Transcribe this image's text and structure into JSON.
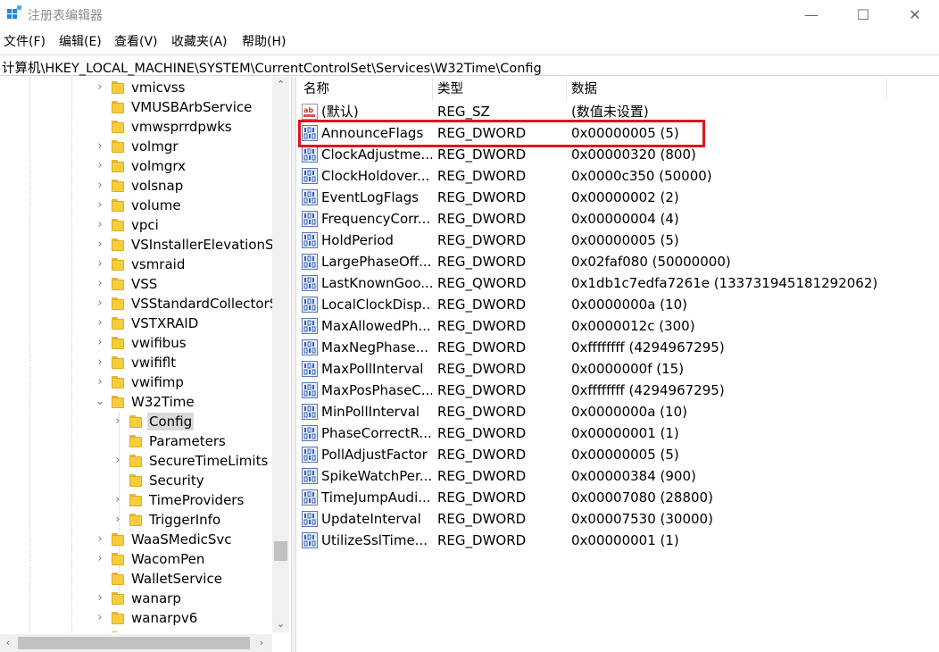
{
  "window": {
    "title": "注册表编辑器",
    "min_glyph": "—",
    "max_glyph": "☐",
    "close_glyph": "✕"
  },
  "menu": [
    "文件(F)",
    "编辑(E)",
    "查看(V)",
    "收藏夹(A)",
    "帮助(H)"
  ],
  "address": "计算机\\HKEY_LOCAL_MACHINE\\SYSTEM\\CurrentControlSet\\Services\\W32Time\\Config",
  "tree": {
    "nodes": [
      {
        "label": "vmicvss",
        "expander": "›",
        "depth": 0
      },
      {
        "label": "VMUSBArbService",
        "expander": "",
        "depth": 0
      },
      {
        "label": "vmwsprrdpwks",
        "expander": "",
        "depth": 0
      },
      {
        "label": "volmgr",
        "expander": "›",
        "depth": 0
      },
      {
        "label": "volmgrx",
        "expander": "›",
        "depth": 0
      },
      {
        "label": "volsnap",
        "expander": "›",
        "depth": 0
      },
      {
        "label": "volume",
        "expander": "›",
        "depth": 0
      },
      {
        "label": "vpci",
        "expander": "›",
        "depth": 0
      },
      {
        "label": "VSInstallerElevationService",
        "expander": "›",
        "depth": 0
      },
      {
        "label": "vsmraid",
        "expander": "›",
        "depth": 0
      },
      {
        "label": "VSS",
        "expander": "›",
        "depth": 0
      },
      {
        "label": "VSStandardCollectorService150",
        "expander": "›",
        "depth": 0
      },
      {
        "label": "VSTXRAID",
        "expander": "›",
        "depth": 0
      },
      {
        "label": "vwifibus",
        "expander": "›",
        "depth": 0
      },
      {
        "label": "vwififlt",
        "expander": "›",
        "depth": 0
      },
      {
        "label": "vwifimp",
        "expander": "›",
        "depth": 0
      },
      {
        "label": "W32Time",
        "expander": "⌄",
        "depth": 0
      },
      {
        "label": "Config",
        "expander": "›",
        "depth": 1,
        "selected": true
      },
      {
        "label": "Parameters",
        "expander": "",
        "depth": 1
      },
      {
        "label": "SecureTimeLimits",
        "expander": "›",
        "depth": 1
      },
      {
        "label": "Security",
        "expander": "",
        "depth": 1
      },
      {
        "label": "TimeProviders",
        "expander": "›",
        "depth": 1
      },
      {
        "label": "TriggerInfo",
        "expander": "›",
        "depth": 1
      },
      {
        "label": "WaaSMedicSvc",
        "expander": "›",
        "depth": 0
      },
      {
        "label": "WacomPen",
        "expander": "›",
        "depth": 0
      },
      {
        "label": "WalletService",
        "expander": "",
        "depth": 0
      },
      {
        "label": "wanarp",
        "expander": "›",
        "depth": 0
      },
      {
        "label": "wanarpv6",
        "expander": "›",
        "depth": 0
      },
      {
        "label": "WarpJITSvc",
        "expander": "›",
        "depth": 0
      }
    ],
    "scroll_up": "⌃",
    "scroll_down": "⌄",
    "scroll_left": "‹",
    "scroll_right": "›"
  },
  "list": {
    "headers": {
      "name": "名称",
      "type": "类型",
      "data": "数据"
    },
    "rows": [
      {
        "name": "(默认)",
        "type": "REG_SZ",
        "data": "(数值未设置)",
        "icon": "string"
      },
      {
        "name": "AnnounceFlags",
        "type": "REG_DWORD",
        "data": "0x00000005 (5)",
        "icon": "binary"
      },
      {
        "name": "ClockAdjustme...",
        "type": "REG_DWORD",
        "data": "0x00000320 (800)",
        "icon": "binary"
      },
      {
        "name": "ClockHoldover...",
        "type": "REG_DWORD",
        "data": "0x0000c350 (50000)",
        "icon": "binary"
      },
      {
        "name": "EventLogFlags",
        "type": "REG_DWORD",
        "data": "0x00000002 (2)",
        "icon": "binary"
      },
      {
        "name": "FrequencyCorr...",
        "type": "REG_DWORD",
        "data": "0x00000004 (4)",
        "icon": "binary"
      },
      {
        "name": "HoldPeriod",
        "type": "REG_DWORD",
        "data": "0x00000005 (5)",
        "icon": "binary"
      },
      {
        "name": "LargePhaseOff...",
        "type": "REG_DWORD",
        "data": "0x02faf080 (50000000)",
        "icon": "binary"
      },
      {
        "name": "LastKnownGoo...",
        "type": "REG_QWORD",
        "data": "0x1db1c7edfa7261e (133731945181292062)",
        "icon": "binary"
      },
      {
        "name": "LocalClockDisp...",
        "type": "REG_DWORD",
        "data": "0x0000000a (10)",
        "icon": "binary"
      },
      {
        "name": "MaxAllowedPh...",
        "type": "REG_DWORD",
        "data": "0x0000012c (300)",
        "icon": "binary"
      },
      {
        "name": "MaxNegPhase...",
        "type": "REG_DWORD",
        "data": "0xffffffff (4294967295)",
        "icon": "binary"
      },
      {
        "name": "MaxPollInterval",
        "type": "REG_DWORD",
        "data": "0x0000000f (15)",
        "icon": "binary"
      },
      {
        "name": "MaxPosPhaseC...",
        "type": "REG_DWORD",
        "data": "0xffffffff (4294967295)",
        "icon": "binary"
      },
      {
        "name": "MinPollInterval",
        "type": "REG_DWORD",
        "data": "0x0000000a (10)",
        "icon": "binary"
      },
      {
        "name": "PhaseCorrectR...",
        "type": "REG_DWORD",
        "data": "0x00000001 (1)",
        "icon": "binary"
      },
      {
        "name": "PollAdjustFactor",
        "type": "REG_DWORD",
        "data": "0x00000005 (5)",
        "icon": "binary"
      },
      {
        "name": "SpikeWatchPer...",
        "type": "REG_DWORD",
        "data": "0x00000384 (900)",
        "icon": "binary"
      },
      {
        "name": "TimeJumpAudi...",
        "type": "REG_DWORD",
        "data": "0x00007080 (28800)",
        "icon": "binary"
      },
      {
        "name": "UpdateInterval",
        "type": "REG_DWORD",
        "data": "0x00007530 (30000)",
        "icon": "binary"
      },
      {
        "name": "UtilizeSslTime...",
        "type": "REG_DWORD",
        "data": "0x00000001 (1)",
        "icon": "binary"
      }
    ],
    "highlighted_row": "AnnounceFlags",
    "highlight_color": "#e0141e"
  }
}
